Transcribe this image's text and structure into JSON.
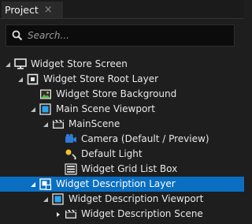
{
  "tab": {
    "label": "Project",
    "close_glyph": "×"
  },
  "search": {
    "placeholder": "Search..."
  },
  "tree": [
    {
      "label": "Widget Store Screen",
      "icon": "screen-icon",
      "state": "expanded",
      "selected": false
    },
    {
      "label": "Widget Store Root Layer",
      "icon": "root-layer-icon",
      "state": "expanded",
      "selected": false
    },
    {
      "label": "Widget Store Background",
      "icon": "image-icon",
      "state": "none",
      "selected": false
    },
    {
      "label": "Main Scene Viewport",
      "icon": "viewport-icon",
      "state": "expanded",
      "selected": false
    },
    {
      "label": "MainScene",
      "icon": "scene-icon",
      "state": "expanded",
      "selected": false
    },
    {
      "label": "Camera (Default / Preview)",
      "icon": "camera-icon",
      "state": "none",
      "selected": false
    },
    {
      "label": "Default Light",
      "icon": "light-icon",
      "state": "none",
      "selected": false
    },
    {
      "label": "Widget Grid List Box",
      "icon": "list-box-icon",
      "state": "none",
      "selected": false
    },
    {
      "label": "Widget Description Layer",
      "icon": "layer-prefab-icon",
      "state": "expanded",
      "selected": true
    },
    {
      "label": "Widget Description Viewport",
      "icon": "viewport-icon",
      "state": "expanded",
      "selected": false
    },
    {
      "label": "Widget Description Scene",
      "icon": "scene-icon",
      "state": "collapsed",
      "selected": false
    }
  ],
  "colors": {
    "selection": "#0a6fc2",
    "viewport_accent": "#2aa7f0",
    "camera_accent": "#2e7bd6",
    "light_accent": "#f2c230"
  }
}
